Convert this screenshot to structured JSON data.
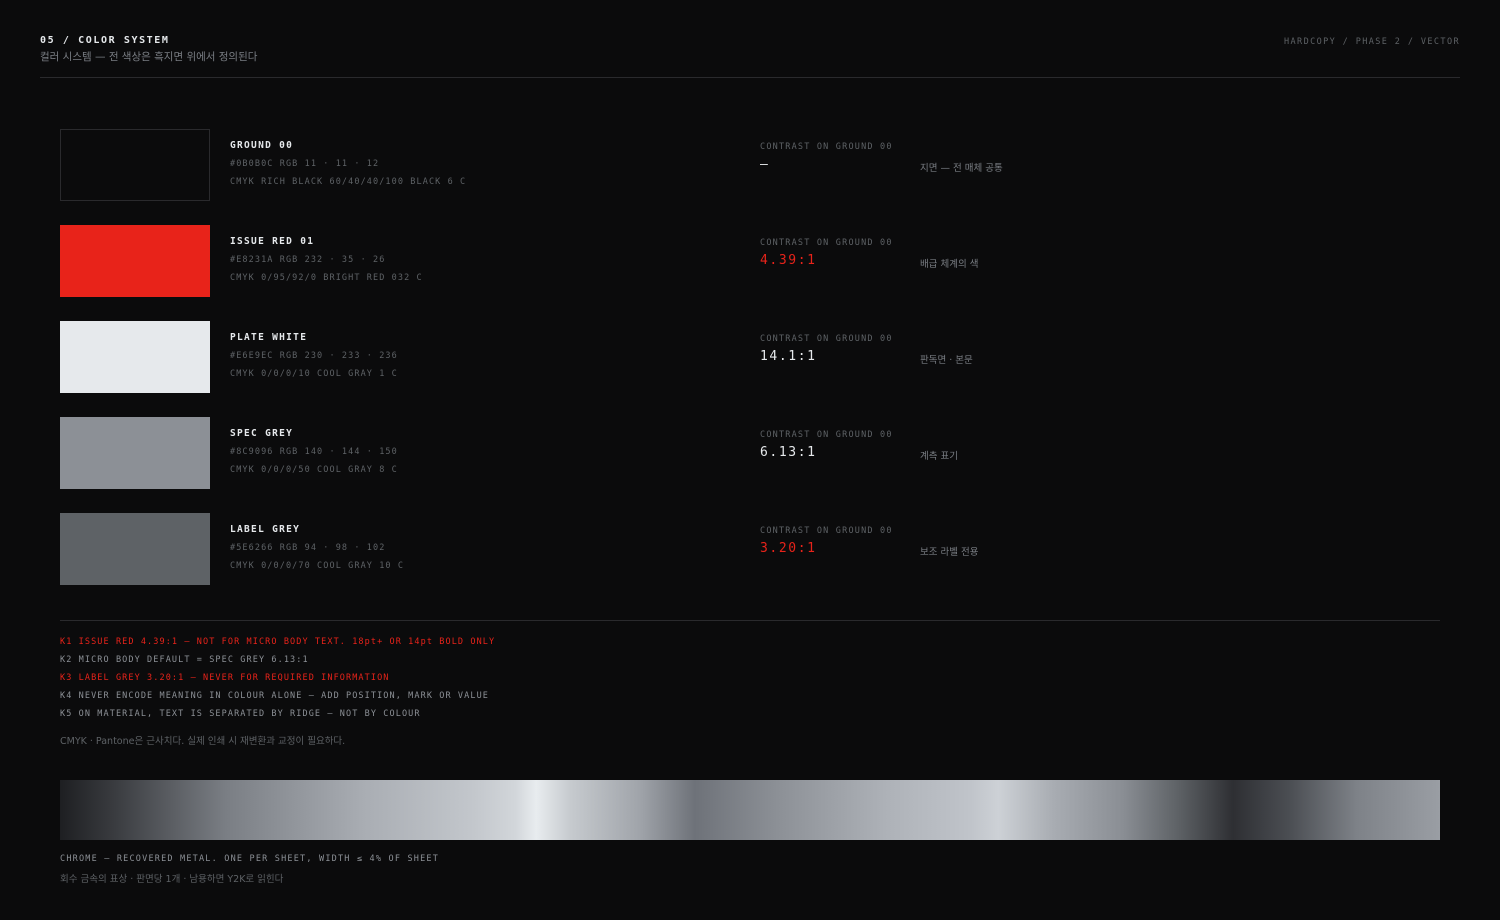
{
  "header": {
    "title": "05 / COLOR SYSTEM",
    "subtitle": "컬러 시스템 — 전 색상은 흑지면 위에서 정의된다",
    "meta": "HARDCOPY / PHASE 2 / VECTOR"
  },
  "colors": [
    {
      "name": "GROUND 00",
      "spec": "#0B0B0C RGB 11 · 11 · 12",
      "cmyk": "CMYK RICH BLACK 60/40/40/100 BLACK 6 C",
      "contrast_label": "CONTRAST ON GROUND 00",
      "contrast": "—",
      "note": "지면 — 전 매체 공통",
      "hex": "#0B0B0C"
    },
    {
      "name": "ISSUE RED 01",
      "spec": "#E8231A RGB 232 · 35 · 26",
      "cmyk": "CMYK 0/95/92/0 BRIGHT RED 032 C",
      "contrast_label": "CONTRAST ON GROUND 00",
      "contrast": "4.39:1",
      "note": "배급 체계의 색",
      "hex": "#E8231A"
    },
    {
      "name": "PLATE WHITE",
      "spec": "#E6E9EC RGB 230 · 233 · 236",
      "cmyk": "CMYK 0/0/0/10 COOL GRAY 1 C",
      "contrast_label": "CONTRAST ON GROUND 00",
      "contrast": "14.1:1",
      "note": "판독면 · 본문",
      "hex": "#E6E9EC"
    },
    {
      "name": "SPEC GREY",
      "spec": "#8C9096 RGB 140 · 144 · 150",
      "cmyk": "CMYK 0/0/0/50 COOL GRAY 8 C",
      "contrast_label": "CONTRAST ON GROUND 00",
      "contrast": "6.13:1",
      "note": "계측 표기",
      "hex": "#8C9096"
    },
    {
      "name": "LABEL GREY",
      "spec": "#5E6266 RGB 94 · 98 · 102",
      "cmyk": "CMYK 0/0/0/70 COOL GRAY 10 C",
      "contrast_label": "CONTRAST ON GROUND 00",
      "contrast": "3.20:1",
      "note": "보조 라벨 전용",
      "hex": "#5E6266"
    }
  ],
  "rules": [
    "K1 ISSUE RED 4.39:1 — NOT FOR MICRO BODY TEXT. 18pt+ OR 14pt BOLD ONLY",
    "K2 MICRO BODY DEFAULT = SPEC GREY 6.13:1",
    "K3 LABEL GREY 3.20:1 — NEVER FOR REQUIRED INFORMATION",
    "K4 NEVER ENCODE MEANING IN COLOUR ALONE — ADD POSITION, MARK OR VALUE",
    "K5 ON MATERIAL, TEXT IS SEPARATED BY RIDGE — NOT BY COLOUR"
  ],
  "disclaimer": "CMYK · Pantone은 근사치다. 실제 인쇄 시 재변환과 교정이 필요하다.",
  "chrome": {
    "caption": "CHROME — RECOVERED METAL. ONE PER SHEET, WIDTH ≤ 4% OF SHEET",
    "subcaption": "회수 금속의 표상 · 판면당 1개 · 남용하면 Y2K로 읽힌다"
  },
  "palette": {
    "ground": "#0B0B0C",
    "accent_red": "#E8231A",
    "plate_white": "#E6E9EC",
    "spec_grey": "#8C9096",
    "label_grey": "#5E6266"
  }
}
